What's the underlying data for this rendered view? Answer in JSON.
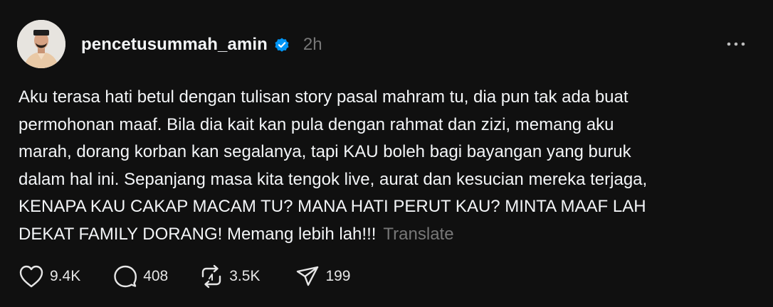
{
  "post": {
    "username": "pencetusummah_amin",
    "time": "2h",
    "verified_icon": "verified-badge-icon",
    "more_icon": "more-icon",
    "text": "Aku terasa hati betul dengan tulisan story pasal mahram tu, dia pun tak ada buat\npermohonan maaf. Bila dia kait kan pula dengan rahmat dan zizi, memang aku\nmarah, dorang korban kan segalanya, tapi KAU boleh bagi bayangan yang buruk\ndalam hal ini. Sepanjang masa kita tengok live, aurat dan kesucian mereka terjaga,\nKENAPA KAU CAKAP MACAM TU? MANA HATI PERUT KAU? MINTA MAAF LAH\nDEKAT FAMILY DORANG! Memang lebih lah!!!",
    "translate_label": "Translate",
    "colors": {
      "background": "#101010",
      "text": "#f3f5f7",
      "muted": "#777777",
      "verified": "#0095f6"
    }
  },
  "actions": {
    "likes": "9.4K",
    "comments": "408",
    "reposts": "3.5K",
    "shares": "199",
    "icons": [
      "heart-icon",
      "comment-icon",
      "repost-icon",
      "share-icon"
    ]
  }
}
